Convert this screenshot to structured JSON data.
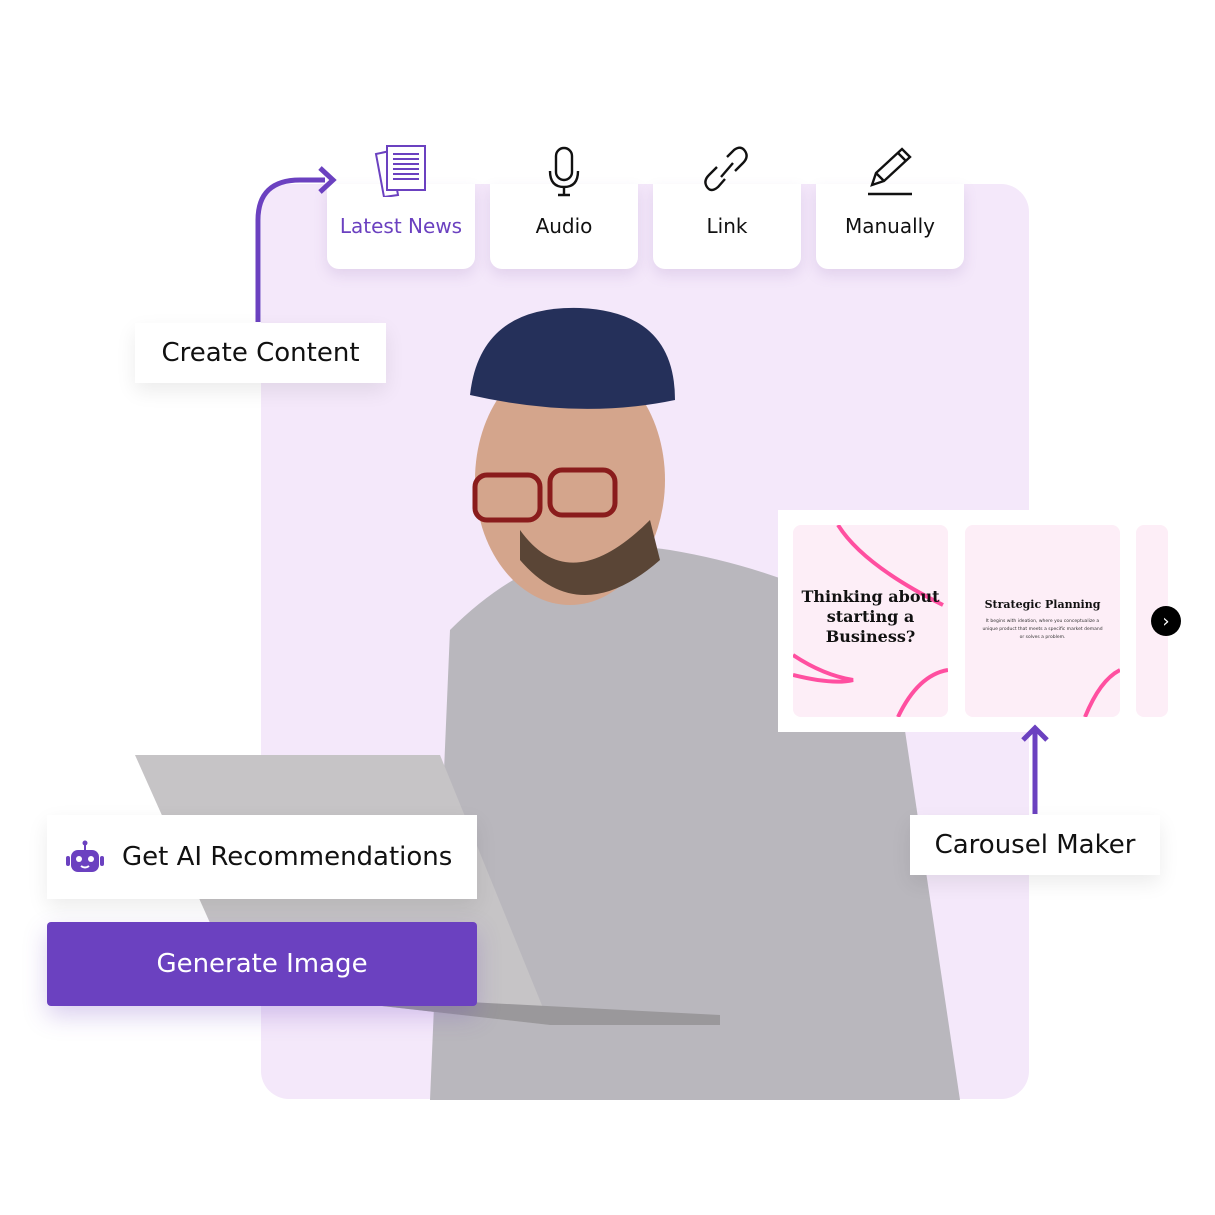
{
  "sources": [
    {
      "label": "Latest News",
      "icon": "news-icon",
      "active": true
    },
    {
      "label": "Audio",
      "icon": "microphone-icon"
    },
    {
      "label": "Link",
      "icon": "link-icon"
    },
    {
      "label": "Manually",
      "icon": "pencil-icon"
    }
  ],
  "create_content": "Create Content",
  "ai_recommendations": "Get AI Recommendations",
  "generate_button": "Generate Image",
  "carousel_label": "Carousel Maker",
  "slides": [
    {
      "title": "Thinking about starting a Business?"
    },
    {
      "title": "Strategic Planning",
      "body": "It begins with ideation, where you conceptualize a unique product that meets a specific market demand or solves a problem."
    }
  ],
  "colors": {
    "accent": "#6b41c0",
    "panel": "#f4e8fa",
    "slide_pink": "#ff4fa0"
  }
}
